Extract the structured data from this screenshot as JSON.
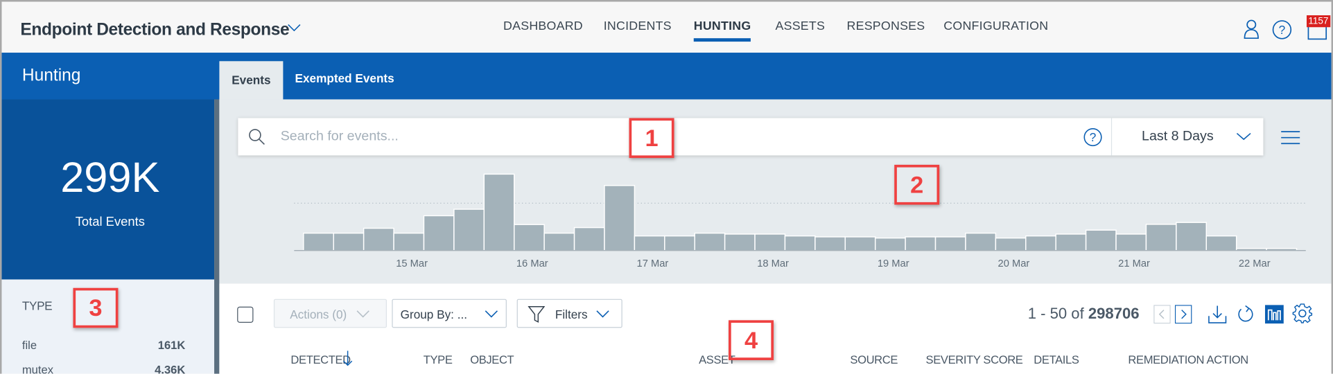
{
  "header": {
    "app_title": "Endpoint Detection and Response",
    "nav": [
      "DASHBOARD",
      "INCIDENTS",
      "HUNTING",
      "ASSETS",
      "RESPONSES",
      "CONFIGURATION"
    ],
    "active_nav": "HUNTING",
    "notification_count": "1157",
    "icons": [
      "user-icon",
      "help-icon",
      "notification-icon"
    ]
  },
  "sidebar": {
    "title": "Hunting",
    "total_value": "299K",
    "total_label": "Total Events",
    "facet_title": "TYPE",
    "facets": [
      {
        "key": "file",
        "value": "161K"
      },
      {
        "key": "mutex",
        "value": "4.36K"
      }
    ]
  },
  "tabs": [
    {
      "label": "Events",
      "active": true
    },
    {
      "label": "Exempted Events",
      "active": false
    }
  ],
  "search": {
    "placeholder": "Search for events...",
    "value": "",
    "range": "Last 8 Days"
  },
  "chart_data": {
    "type": "bar",
    "x_ticks": [
      "15 Mar",
      "16 Mar",
      "17 Mar",
      "18 Mar",
      "19 Mar",
      "20 Mar",
      "21 Mar",
      "22 Mar"
    ],
    "values": [
      75,
      75,
      96,
      75,
      150,
      178,
      329,
      112,
      75,
      99,
      280,
      63,
      63,
      75,
      71,
      71,
      63,
      59,
      59,
      54,
      59,
      59,
      75,
      54,
      63,
      71,
      88,
      71,
      113,
      121,
      63,
      9,
      9
    ],
    "reference_line": 204,
    "bar_color": "#a3b2ba",
    "grid": false
  },
  "toolbar": {
    "actions_label": "Actions (0)",
    "group_by_label": "Group By: ...",
    "filters_label": "Filters",
    "pagination_range": "1 - 50 of",
    "pagination_total": "298706"
  },
  "table": {
    "columns": [
      "DETECTED",
      "TYPE",
      "OBJECT",
      "ASSET",
      "SOURCE",
      "SEVERITY SCORE",
      "DETAILS",
      "REMEDIATION ACTION"
    ],
    "sort_column": "DETECTED",
    "sort_direction": "descending"
  },
  "annotations": [
    "1",
    "2",
    "3",
    "4"
  ],
  "colors": {
    "brand": "#0b5fb3",
    "sidebar_dark": "#09529a",
    "badge": "#d9201e",
    "annotation": "#ef4141"
  }
}
